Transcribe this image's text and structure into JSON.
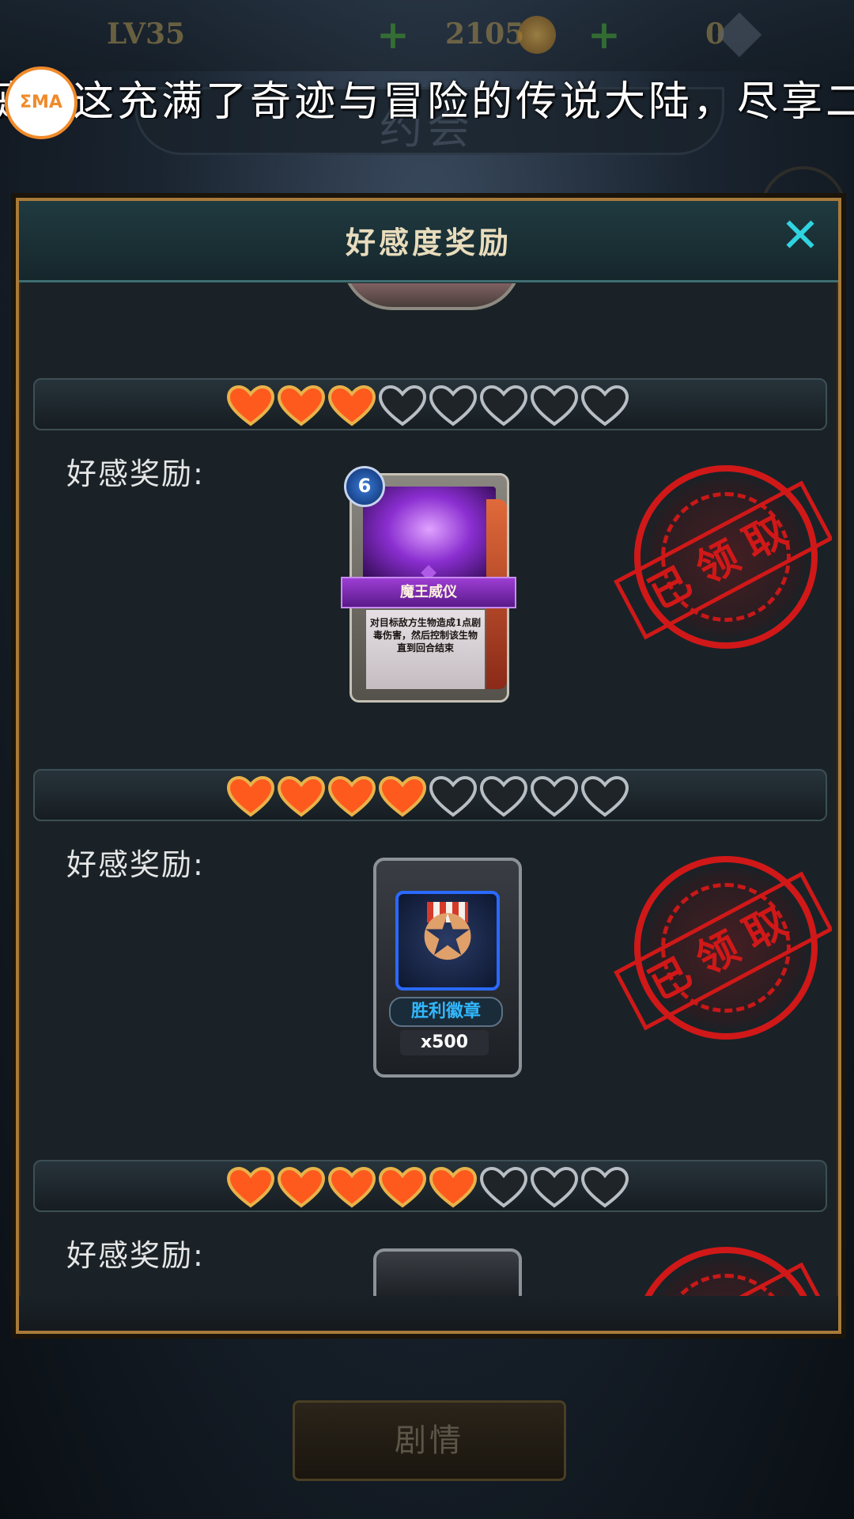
{
  "background": {
    "stats": {
      "level": "LV35",
      "coins": "2105",
      "gems": "0"
    },
    "scene_title": "约会",
    "story_button": "剧情"
  },
  "marquee_text": "蓰到这充满了奇迹与冒险的传说大陆，尽享二",
  "logo_text": "ΣMA",
  "modal": {
    "title": "好感度奖励",
    "close_label": "✕",
    "sections": [
      {
        "hearts_filled": 3,
        "hearts_total": 8,
        "label": "好感奖励:",
        "reward": {
          "kind": "spell-card",
          "cost": "6",
          "name": "魔王威仪",
          "description": "对目标敌方生物造成1点剧毒伤害，然后控制该生物直到回合结束"
        },
        "stamp": "已领取"
      },
      {
        "hearts_filled": 4,
        "hearts_total": 8,
        "label": "好感奖励:",
        "reward": {
          "kind": "item",
          "name": "胜利徽章",
          "quantity": "x500"
        },
        "stamp": "已领取"
      },
      {
        "hearts_filled": 5,
        "hearts_total": 8,
        "label": "好感奖励:",
        "stamp": "已领取"
      }
    ]
  },
  "colors": {
    "heart_filled": "#ff5a1e",
    "heart_empty": "#1e2428",
    "stamp_red": "#d01818",
    "close_cyan": "#2fd4e0",
    "modal_border": "#a87a3a"
  }
}
